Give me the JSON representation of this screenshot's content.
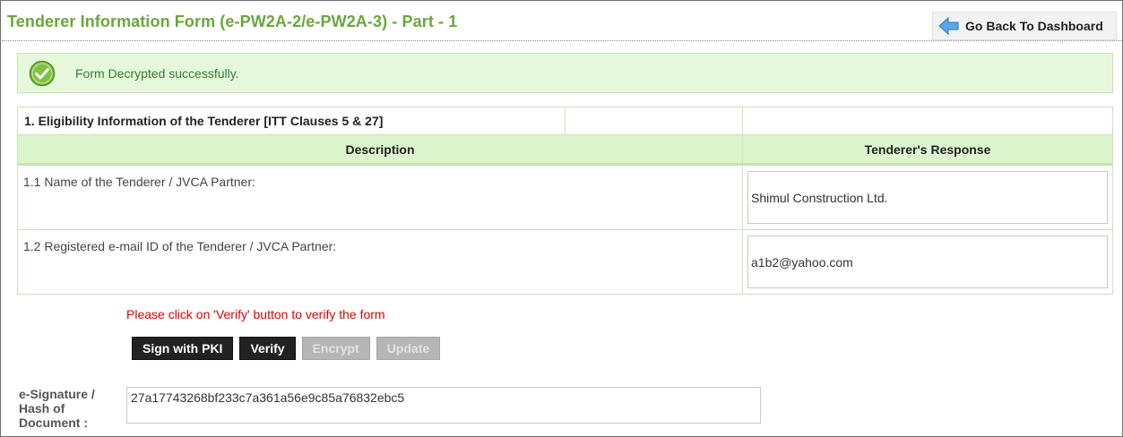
{
  "header": {
    "title": "Tenderer Information Form (e-PW2A-2/e-PW2A-3) - Part - 1",
    "back_label": "Go Back To Dashboard"
  },
  "alert": {
    "message": "Form Decrypted successfully.",
    "color": "#2e7d32"
  },
  "section": {
    "title": "1. Eligibility Information of the Tenderer [ITT Clauses 5 & 27]"
  },
  "table": {
    "headers": [
      "Description",
      "Tenderer's Response"
    ],
    "rows": [
      {
        "description": "1.1 Name of the Tenderer / JVCA Partner:",
        "response": "Shimul Construction Ltd."
      },
      {
        "description": "1.2 Registered e-mail ID of the Tenderer / JVCA Partner:",
        "response": "a1b2@yahoo.com"
      }
    ]
  },
  "verify_message": "Please click on 'Verify' button to verify the form",
  "buttons": {
    "sign": "Sign with PKI",
    "verify": "Verify",
    "encrypt": "Encrypt",
    "update": "Update"
  },
  "signature": {
    "label": "e-Signature / Hash of Document :",
    "value": "27a17743268bf233c7a361a56e9c85a76832ebc5"
  },
  "colors": {
    "title": "#6aa63c",
    "header_bg": "#dcf5cd",
    "alert_bg": "#e6f8dc",
    "error": "#e50000"
  },
  "icons": {
    "back": "back-arrow-icon",
    "success": "check-circle-icon"
  }
}
